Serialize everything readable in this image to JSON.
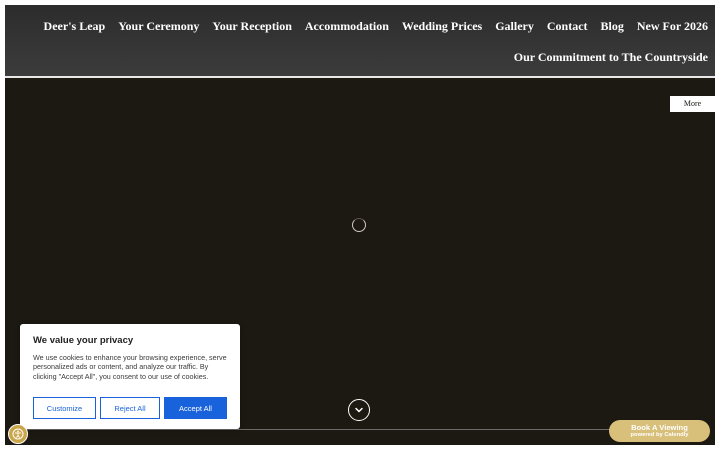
{
  "nav": {
    "primary": [
      "Deer's Leap",
      "Your Ceremony",
      "Your Reception",
      "Accommodation",
      "Wedding Prices",
      "Gallery",
      "Contact",
      "Blog",
      "New For 2026"
    ],
    "secondary": [
      "Our Commitment to The Countryside"
    ]
  },
  "hero": {
    "more_label": "More"
  },
  "cookie": {
    "title": "We value your privacy",
    "text": "We use cookies to enhance your browsing experience, serve personalized ads or content, and analyze our traffic. By clicking \"Accept All\", you consent to our use of cookies.",
    "customize_label": "Customize",
    "reject_label": "Reject All",
    "accept_label": "Accept All",
    "accent_color": "#1863dc"
  },
  "calendly": {
    "main_label": "Book A Viewing",
    "sub_label": "powered by Calendly",
    "color": "#d8c07a"
  },
  "icons": {
    "accessibility": "accessibility-icon",
    "scroll": "chevron-down-icon",
    "loading": "loading-spinner"
  }
}
